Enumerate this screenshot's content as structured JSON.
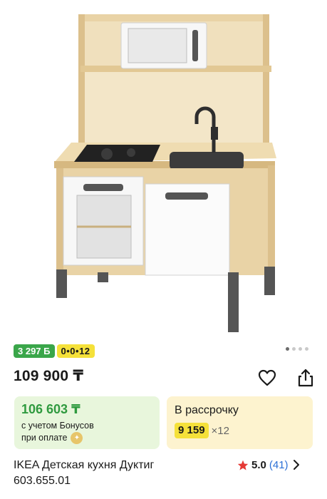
{
  "product": {
    "image_alt": "IKEA kitchen toy",
    "price": "109 900 ₸",
    "title": "IKEA Детская кухня Дуктиг",
    "article": "603.655.01",
    "rating": "5.0",
    "reviews": "(41)"
  },
  "badges": {
    "bonus": "3 297 Б",
    "installment": "0•0•12"
  },
  "bonus_card": {
    "price": "106 603 ₸",
    "line1": "с учетом Бонусов",
    "line2": "при оплате"
  },
  "installment_card": {
    "title": "В рассрочку",
    "amount": "9 159",
    "months": "×12"
  },
  "colors": {
    "green": "#3aa64a",
    "yellow": "#f5e13a",
    "link": "#2a6fd6",
    "star": "#e53935"
  },
  "icons": [
    "heart-icon",
    "share-icon",
    "star-icon",
    "chevron-right-icon",
    "coin-icon"
  ]
}
